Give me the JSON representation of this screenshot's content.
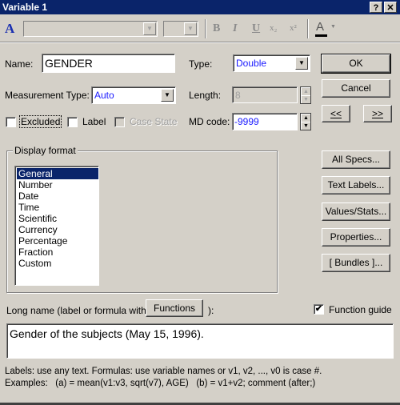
{
  "window": {
    "title": "Variable 1",
    "help_button": "?",
    "close_button": "✕"
  },
  "toolbar": {
    "font_icon": "A",
    "font_name_value": "",
    "font_size_value": "",
    "bold_icon": "B",
    "italic_icon": "I",
    "underline_icon": "U",
    "subscript_icon": "x₂",
    "superscript_icon": "x²",
    "font_color_icon": "A"
  },
  "form": {
    "name_label": "Name:",
    "name_value": "GENDER",
    "type_label": "Type:",
    "type_value": "Double",
    "measurement_type_label": "Measurement Type:",
    "measurement_type_value": "Auto",
    "length_label": "Length:",
    "length_value": "8",
    "md_code_label": "MD code:",
    "md_code_value": "-9999",
    "excluded_label": "Excluded",
    "excluded_checked": false,
    "label_label": "Label",
    "label_checked": false,
    "case_state_label": "Case State",
    "case_state_checked": false
  },
  "buttons": {
    "ok": "OK",
    "cancel": "Cancel",
    "prev": "<<",
    "next": ">>",
    "all_specs": "All Specs...",
    "text_labels": "Text Labels...",
    "values_stats": "Values/Stats...",
    "properties": "Properties...",
    "bundles": "[ Bundles ]...",
    "functions": "Functions"
  },
  "display_format": {
    "legend": "Display format",
    "selected": "General",
    "items": [
      "General",
      "Number",
      "Date",
      "Time",
      "Scientific",
      "Currency",
      "Percentage",
      "Fraction",
      "Custom"
    ]
  },
  "long_name": {
    "label_prefix": "Long name (label or formula with",
    "label_suffix": "):",
    "value": "Gender of the subjects (May 15, 1996).",
    "function_guide_label": "Function guide",
    "function_guide_checked": true
  },
  "footer": {
    "line1": "Labels: use any text.  Formulas: use variable names or v1, v2, ..., v0 is case #.",
    "line2": "Examples:   (a) = mean(v1:v3, sqrt(v7), AGE)   (b) = v1+v2; comment (after;)"
  }
}
